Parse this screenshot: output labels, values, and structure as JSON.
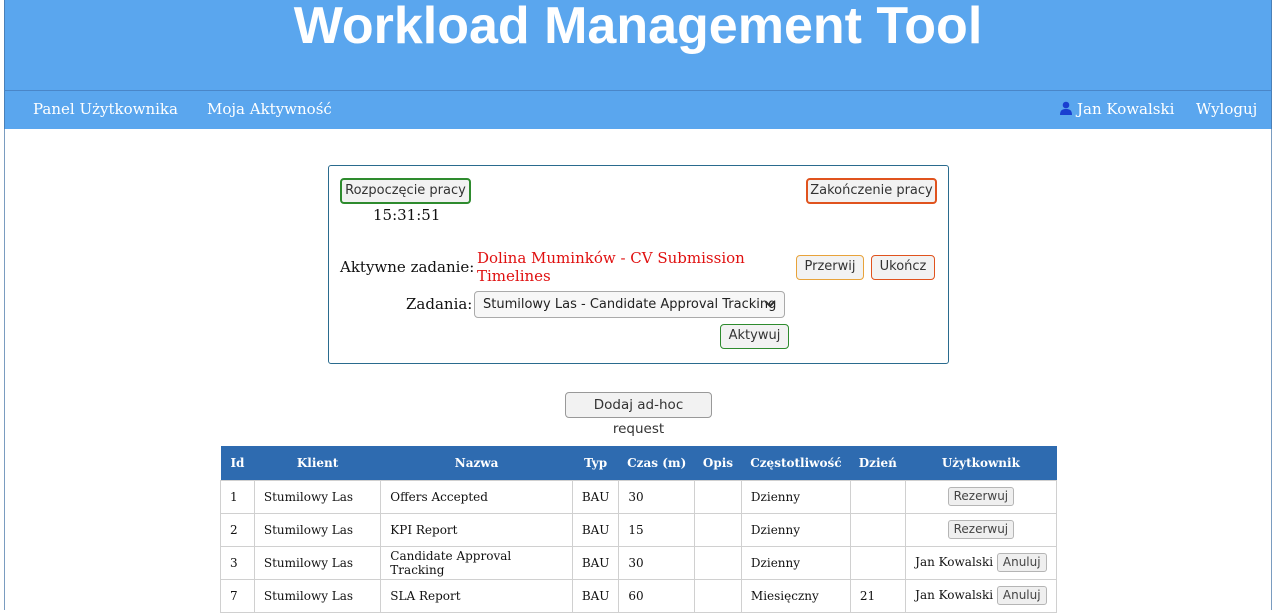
{
  "app": {
    "title": "Workload Management Tool"
  },
  "nav": {
    "items": [
      {
        "label": "Panel Użytkownika"
      },
      {
        "label": "Moja Aktywność"
      }
    ],
    "user_name": "Jan Kowalski",
    "logout_label": "Wyloguj"
  },
  "work_panel": {
    "start_label": "Rozpoczęcie pracy",
    "start_time": "15:31:51",
    "end_label": "Zakończenie pracy",
    "active_task_label": "Aktywne zadanie:",
    "active_task_value": "Dolina Muminków - CV Submission Timelines",
    "pause_label": "Przerwij",
    "finish_label": "Ukończ",
    "tasks_label": "Zadania:",
    "tasks_selected": "Stumilowy Las - Candidate Approval Tracking",
    "activate_label": "Aktywuj"
  },
  "adhoc_label": "Dodaj ad-hoc request",
  "table": {
    "headers": [
      "Id",
      "Klient",
      "Nazwa",
      "Typ",
      "Czas (m)",
      "Opis",
      "Częstotliwość",
      "Dzień",
      "Użytkownik"
    ],
    "rows": [
      {
        "id": "1",
        "client": "Stumilowy Las",
        "name": "Offers Accepted",
        "type": "BAU",
        "time": "30",
        "desc": "",
        "freq": "Dzienny",
        "day": "",
        "user": "",
        "action": "Rezerwuj"
      },
      {
        "id": "2",
        "client": "Stumilowy Las",
        "name": "KPI Report",
        "type": "BAU",
        "time": "15",
        "desc": "",
        "freq": "Dzienny",
        "day": "",
        "user": "",
        "action": "Rezerwuj"
      },
      {
        "id": "3",
        "client": "Stumilowy Las",
        "name": "Candidate Approval Tracking",
        "type": "BAU",
        "time": "30",
        "desc": "",
        "freq": "Dzienny",
        "day": "",
        "user": "Jan Kowalski",
        "action": "Anuluj"
      },
      {
        "id": "7",
        "client": "Stumilowy Las",
        "name": "SLA Report",
        "type": "BAU",
        "time": "60",
        "desc": "",
        "freq": "Miesięczny",
        "day": "21",
        "user": "Jan Kowalski",
        "action": "Anuluj"
      }
    ]
  },
  "colors": {
    "header_bg": "#5aa6ee",
    "table_header_bg": "#2e6bb0",
    "start_border": "#2e8b2e",
    "end_border": "#e0531e",
    "active_task_text": "#e01010"
  }
}
